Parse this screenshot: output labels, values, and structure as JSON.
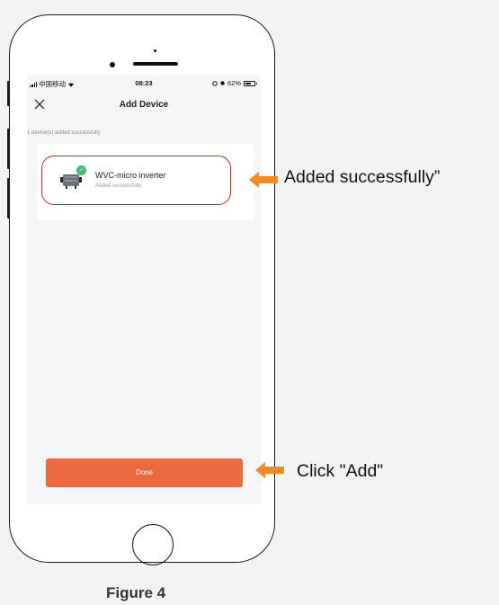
{
  "status_bar": {
    "carrier": "中国移动",
    "time": "08:23",
    "battery": "62%"
  },
  "nav": {
    "title": "Add Device",
    "close_icon": "close-icon"
  },
  "subtitle": "1 device(s) added successfully",
  "device": {
    "name": "WVC-micro inverter",
    "status": "Added successfully",
    "badge_icon": "check-icon"
  },
  "done_button": {
    "label": "Done"
  },
  "annotations": {
    "added": "Added successfully”",
    "click": "Click \"Add\""
  },
  "caption": "Figure 4",
  "colors": {
    "accent_button": "#ed6a40",
    "highlight_border": "#d9231c",
    "arrow": "#f28a1e",
    "check_badge": "#3bbf73"
  }
}
